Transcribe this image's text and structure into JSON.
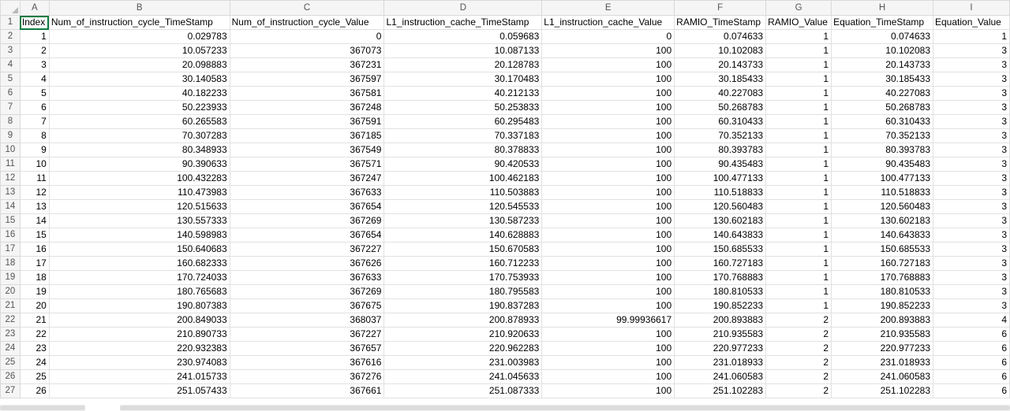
{
  "column_letters": [
    "A",
    "B",
    "C",
    "D",
    "E",
    "F",
    "G",
    "H",
    "I"
  ],
  "header_row": {
    "row_number": "1",
    "cells": [
      "Index",
      "Num_of_instruction_cycle_TimeStamp",
      "Num_of_instruction_cycle_Value",
      "L1_instruction_cache_TimeStamp",
      "L1_instruction_cache_Value",
      "RAMIO_TimeStamp",
      "RAMIO_Value",
      "Equation_TimeStamp",
      "Equation_Value"
    ]
  },
  "rows": [
    {
      "row_number": "2",
      "cells": [
        "1",
        "0.029783",
        "0",
        "0.059683",
        "0",
        "0.074633",
        "1",
        "0.074633",
        "1"
      ]
    },
    {
      "row_number": "3",
      "cells": [
        "2",
        "10.057233",
        "367073",
        "10.087133",
        "100",
        "10.102083",
        "1",
        "10.102083",
        "3"
      ]
    },
    {
      "row_number": "4",
      "cells": [
        "3",
        "20.098883",
        "367231",
        "20.128783",
        "100",
        "20.143733",
        "1",
        "20.143733",
        "3"
      ]
    },
    {
      "row_number": "5",
      "cells": [
        "4",
        "30.140583",
        "367597",
        "30.170483",
        "100",
        "30.185433",
        "1",
        "30.185433",
        "3"
      ]
    },
    {
      "row_number": "6",
      "cells": [
        "5",
        "40.182233",
        "367581",
        "40.212133",
        "100",
        "40.227083",
        "1",
        "40.227083",
        "3"
      ]
    },
    {
      "row_number": "7",
      "cells": [
        "6",
        "50.223933",
        "367248",
        "50.253833",
        "100",
        "50.268783",
        "1",
        "50.268783",
        "3"
      ]
    },
    {
      "row_number": "8",
      "cells": [
        "7",
        "60.265583",
        "367591",
        "60.295483",
        "100",
        "60.310433",
        "1",
        "60.310433",
        "3"
      ]
    },
    {
      "row_number": "9",
      "cells": [
        "8",
        "70.307283",
        "367185",
        "70.337183",
        "100",
        "70.352133",
        "1",
        "70.352133",
        "3"
      ]
    },
    {
      "row_number": "10",
      "cells": [
        "9",
        "80.348933",
        "367549",
        "80.378833",
        "100",
        "80.393783",
        "1",
        "80.393783",
        "3"
      ]
    },
    {
      "row_number": "11",
      "cells": [
        "10",
        "90.390633",
        "367571",
        "90.420533",
        "100",
        "90.435483",
        "1",
        "90.435483",
        "3"
      ]
    },
    {
      "row_number": "12",
      "cells": [
        "11",
        "100.432283",
        "367247",
        "100.462183",
        "100",
        "100.477133",
        "1",
        "100.477133",
        "3"
      ]
    },
    {
      "row_number": "13",
      "cells": [
        "12",
        "110.473983",
        "367633",
        "110.503883",
        "100",
        "110.518833",
        "1",
        "110.518833",
        "3"
      ]
    },
    {
      "row_number": "14",
      "cells": [
        "13",
        "120.515633",
        "367654",
        "120.545533",
        "100",
        "120.560483",
        "1",
        "120.560483",
        "3"
      ]
    },
    {
      "row_number": "15",
      "cells": [
        "14",
        "130.557333",
        "367269",
        "130.587233",
        "100",
        "130.602183",
        "1",
        "130.602183",
        "3"
      ]
    },
    {
      "row_number": "16",
      "cells": [
        "15",
        "140.598983",
        "367654",
        "140.628883",
        "100",
        "140.643833",
        "1",
        "140.643833",
        "3"
      ]
    },
    {
      "row_number": "17",
      "cells": [
        "16",
        "150.640683",
        "367227",
        "150.670583",
        "100",
        "150.685533",
        "1",
        "150.685533",
        "3"
      ]
    },
    {
      "row_number": "18",
      "cells": [
        "17",
        "160.682333",
        "367626",
        "160.712233",
        "100",
        "160.727183",
        "1",
        "160.727183",
        "3"
      ]
    },
    {
      "row_number": "19",
      "cells": [
        "18",
        "170.724033",
        "367633",
        "170.753933",
        "100",
        "170.768883",
        "1",
        "170.768883",
        "3"
      ]
    },
    {
      "row_number": "20",
      "cells": [
        "19",
        "180.765683",
        "367269",
        "180.795583",
        "100",
        "180.810533",
        "1",
        "180.810533",
        "3"
      ]
    },
    {
      "row_number": "21",
      "cells": [
        "20",
        "190.807383",
        "367675",
        "190.837283",
        "100",
        "190.852233",
        "1",
        "190.852233",
        "3"
      ]
    },
    {
      "row_number": "22",
      "cells": [
        "21",
        "200.849033",
        "368037",
        "200.878933",
        "99.99936617",
        "200.893883",
        "2",
        "200.893883",
        "4"
      ]
    },
    {
      "row_number": "23",
      "cells": [
        "22",
        "210.890733",
        "367227",
        "210.920633",
        "100",
        "210.935583",
        "2",
        "210.935583",
        "6"
      ]
    },
    {
      "row_number": "24",
      "cells": [
        "23",
        "220.932383",
        "367657",
        "220.962283",
        "100",
        "220.977233",
        "2",
        "220.977233",
        "6"
      ]
    },
    {
      "row_number": "25",
      "cells": [
        "24",
        "230.974083",
        "367616",
        "231.003983",
        "100",
        "231.018933",
        "2",
        "231.018933",
        "6"
      ]
    },
    {
      "row_number": "26",
      "cells": [
        "25",
        "241.015733",
        "367276",
        "241.045633",
        "100",
        "241.060583",
        "2",
        "241.060583",
        "6"
      ]
    },
    {
      "row_number": "27",
      "cells": [
        "26",
        "251.057433",
        "367661",
        "251.087333",
        "100",
        "251.102283",
        "2",
        "251.102283",
        "6"
      ]
    }
  ]
}
